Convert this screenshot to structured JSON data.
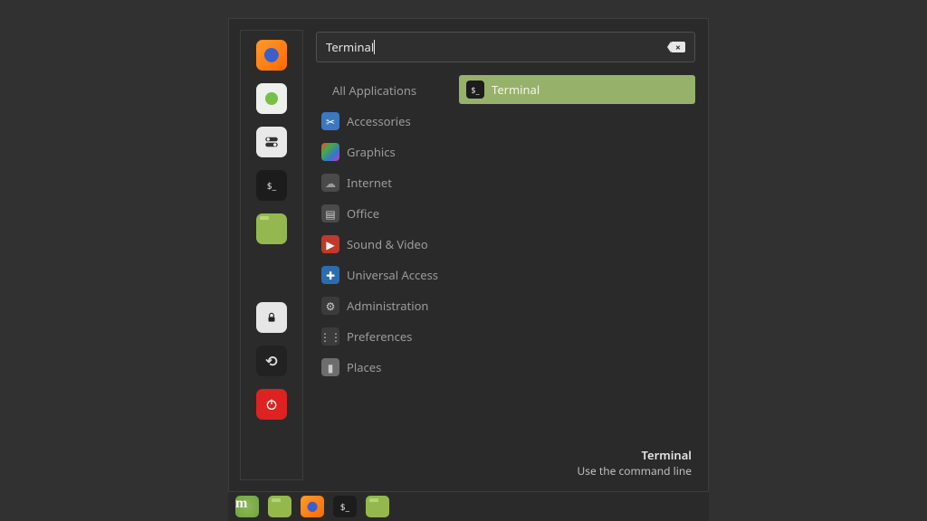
{
  "search": {
    "value": "Terminal"
  },
  "favorites": [
    {
      "name": "firefox",
      "icon": "firefox"
    },
    {
      "name": "software",
      "icon": "apps"
    },
    {
      "name": "settings",
      "icon": "toggle"
    },
    {
      "name": "terminal",
      "icon": "term"
    },
    {
      "name": "files",
      "icon": "files"
    },
    {
      "spacer": true
    },
    {
      "name": "lock",
      "icon": "lock"
    },
    {
      "name": "logout",
      "icon": "logout"
    },
    {
      "name": "power",
      "icon": "power"
    }
  ],
  "categories": [
    {
      "label": "All Applications",
      "icon": null
    },
    {
      "label": "Accessories",
      "icon": "blue",
      "glyph": "✂"
    },
    {
      "label": "Graphics",
      "icon": "rgb"
    },
    {
      "label": "Internet",
      "icon": "cloud",
      "glyph": "☁"
    },
    {
      "label": "Office",
      "icon": "gray",
      "glyph": "▤"
    },
    {
      "label": "Sound & Video",
      "icon": "red",
      "glyph": "▶"
    },
    {
      "label": "Universal Access",
      "icon": "blue2",
      "glyph": "✚"
    },
    {
      "label": "Administration",
      "icon": "dgray",
      "glyph": "⚙"
    },
    {
      "label": "Preferences",
      "icon": "dgray",
      "glyph": "⋮⋮"
    },
    {
      "label": "Places",
      "icon": "fold",
      "glyph": "▮"
    }
  ],
  "results": [
    {
      "label": "Terminal",
      "icon": "term"
    }
  ],
  "selected": {
    "title": "Terminal",
    "desc": "Use the command line"
  },
  "taskbar": [
    {
      "name": "menu",
      "icon": "mint"
    },
    {
      "name": "desktop",
      "icon": "files"
    },
    {
      "name": "firefox",
      "icon": "firefox"
    },
    {
      "name": "terminal",
      "icon": "term"
    },
    {
      "name": "files",
      "icon": "files"
    }
  ]
}
